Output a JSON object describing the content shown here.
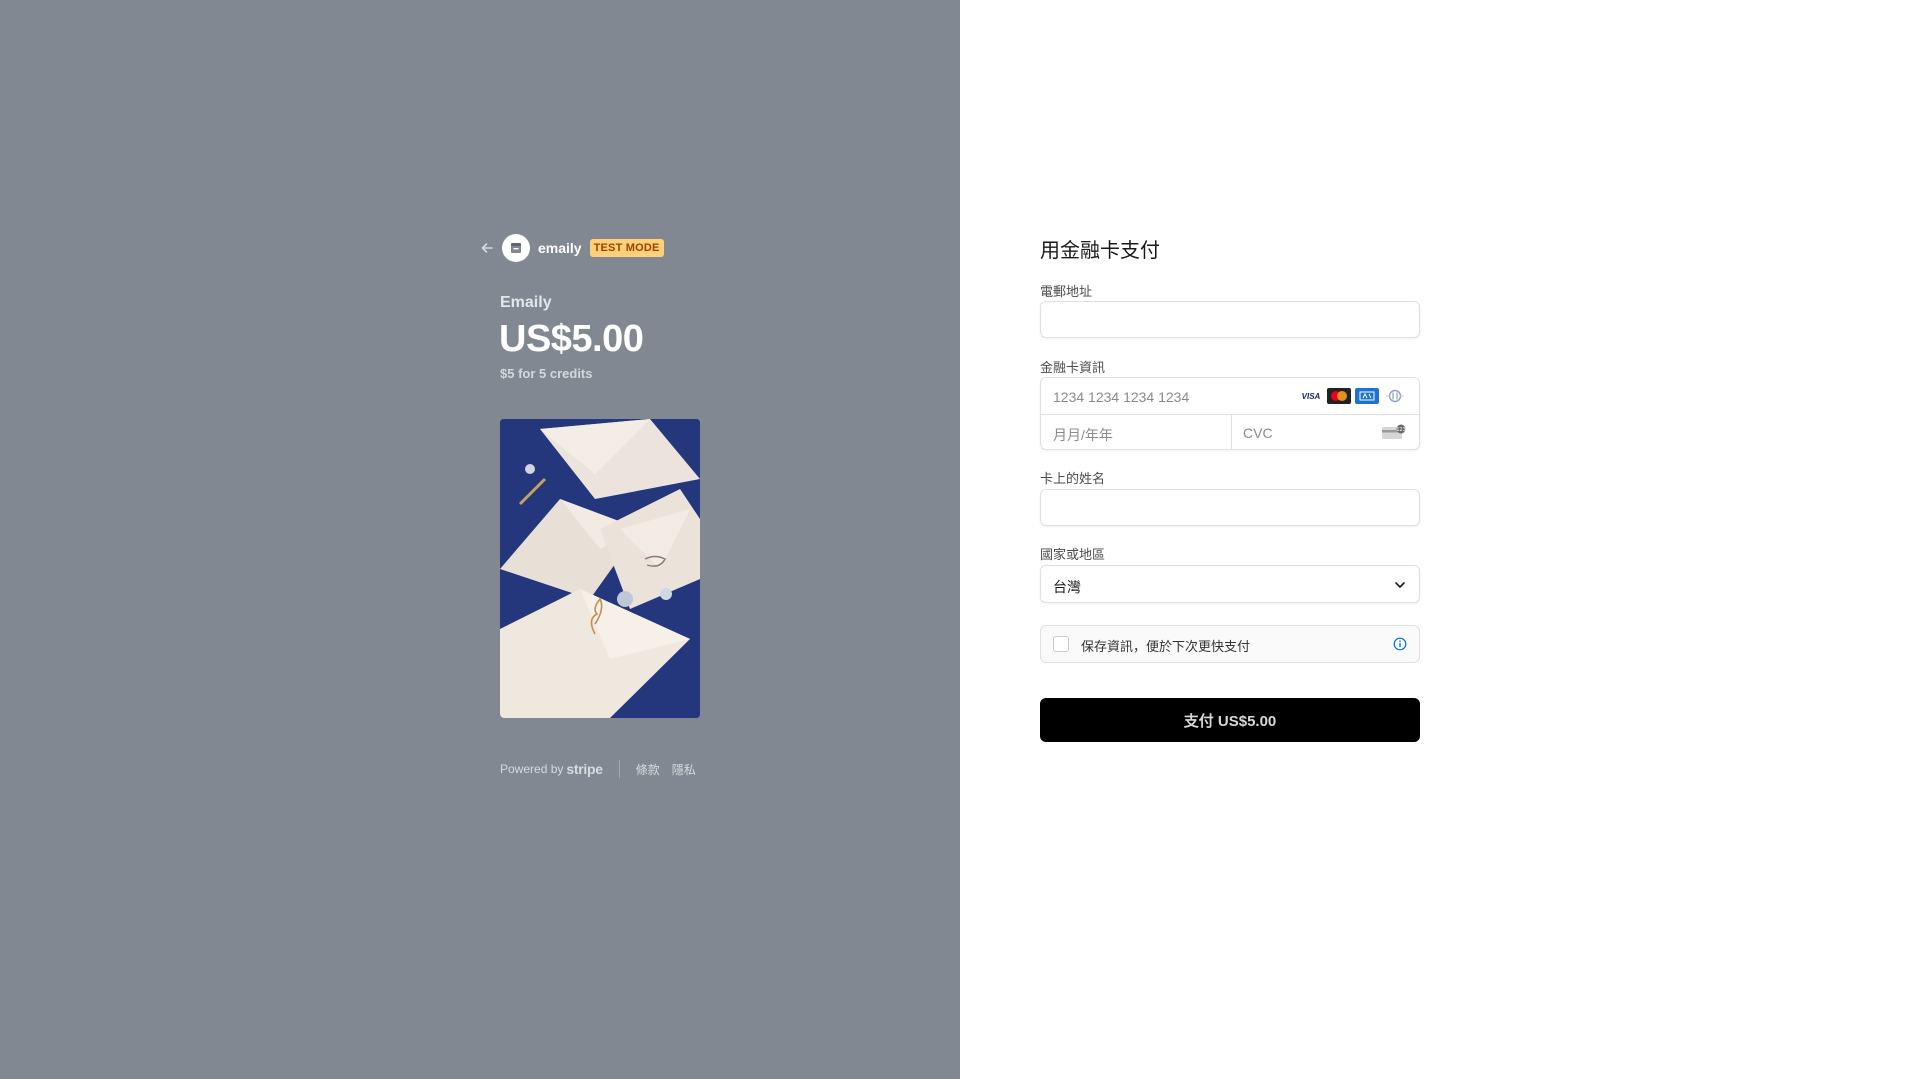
{
  "merchant": {
    "name": "emaily",
    "test_badge": "TEST MODE"
  },
  "product": {
    "name": "Emaily",
    "price": "US$5.00",
    "description": "$5 for 5 credits"
  },
  "footer": {
    "powered_by": "Powered by",
    "stripe": "stripe",
    "terms": "條款",
    "privacy": "隱私"
  },
  "form": {
    "title": "用金融卡支付",
    "email_label": "電郵地址",
    "email_value": "",
    "card_label": "金融卡資訊",
    "card_number_placeholder": "1234 1234 1234 1234",
    "expiry_placeholder": "月月/年年",
    "cvc_placeholder": "CVC",
    "card_brands": [
      "visa-icon",
      "mastercard-icon",
      "amex-icon",
      "diners-icon"
    ],
    "name_label": "卡上的姓名",
    "name_value": "",
    "country_label": "國家或地區",
    "country_value": "台灣",
    "save_info_label": "保存資訊，便於下次更快支付",
    "pay_button": "支付 US$5.00"
  },
  "colors": {
    "left_panel_bg": "#818891",
    "test_badge_bg": "#ffd27a",
    "test_badge_text": "#a13f00",
    "pay_button_bg": "#000000",
    "info_icon": "#0570de"
  }
}
